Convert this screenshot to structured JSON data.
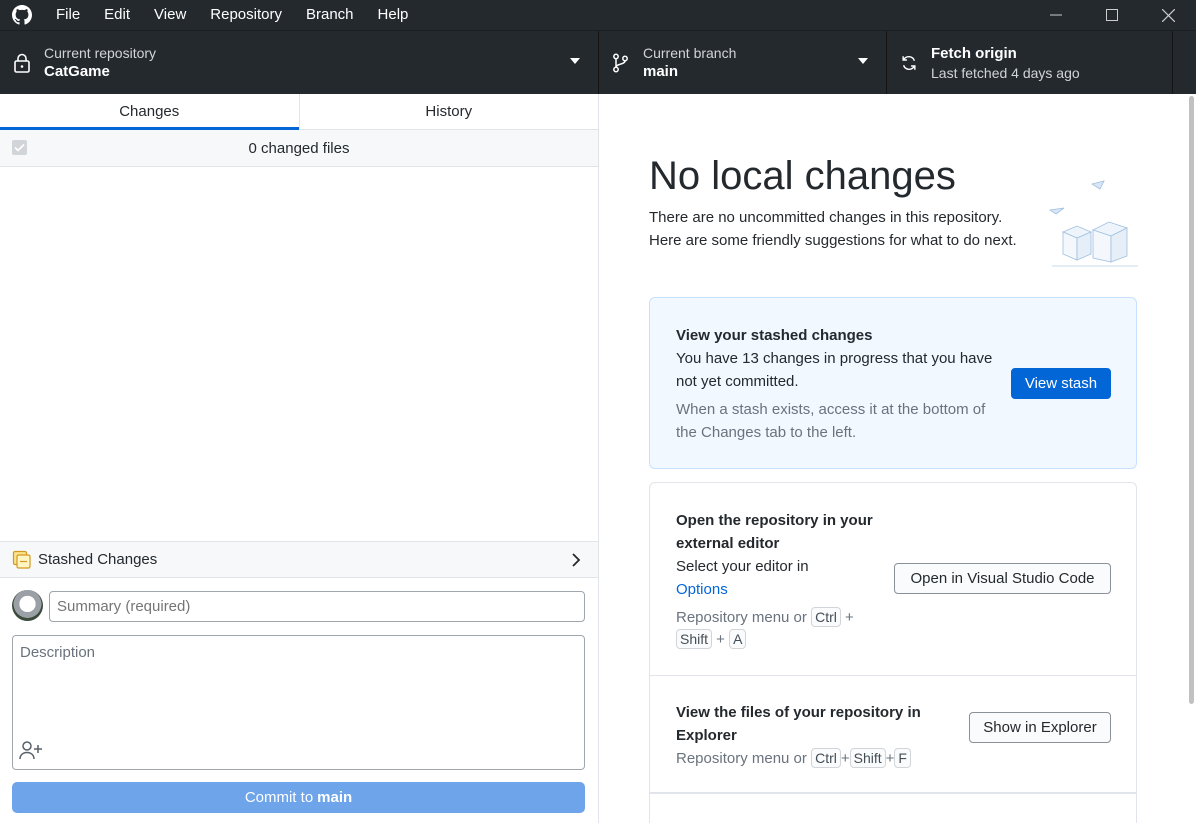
{
  "menu": [
    "File",
    "Edit",
    "View",
    "Repository",
    "Branch",
    "Help"
  ],
  "toolbar": {
    "repo_label": "Current repository",
    "repo_value": "CatGame",
    "branch_label": "Current branch",
    "branch_value": "main",
    "fetch_label": "Fetch origin",
    "fetch_sub": "Last fetched 4 days ago"
  },
  "tabs": [
    "Changes",
    "History"
  ],
  "active_tab": "Changes",
  "changes_header": "0 changed files",
  "stashed_label": "Stashed Changes",
  "summary_placeholder": "Summary (required)",
  "description_placeholder": "Description",
  "commit": {
    "prefix": "Commit to",
    "branch": "main"
  },
  "main": {
    "title": "No local changes",
    "intro": "There are no uncommitted changes in this repository. Here are some friendly suggestions for what to do next.",
    "stash_card": {
      "title": "View your stashed changes",
      "text": "You have 13 changes in progress that you have not yet committed.",
      "muted": "When a stash exists, access it at the bottom of the Changes tab to the left.",
      "button": "View stash"
    },
    "editor_card": {
      "title": "Open the repository in your external editor",
      "text": "Select your editor in",
      "link": "Options",
      "shortcut_prefix": "Repository menu or",
      "keys": [
        "Ctrl",
        "Shift",
        "A"
      ],
      "button": "Open in Visual Studio Code"
    },
    "explorer_card": {
      "title": "View the files of your repository in Explorer",
      "shortcut_prefix": "Repository menu or",
      "keys": [
        "Ctrl",
        "Shift",
        "F"
      ],
      "button": "Show in Explorer"
    }
  },
  "colors": {
    "toolbar_bg": "#24292e",
    "accent": "#0366d6",
    "commit_button": "#6ea4ea",
    "stash_card_bg": "#f1f8ff"
  }
}
